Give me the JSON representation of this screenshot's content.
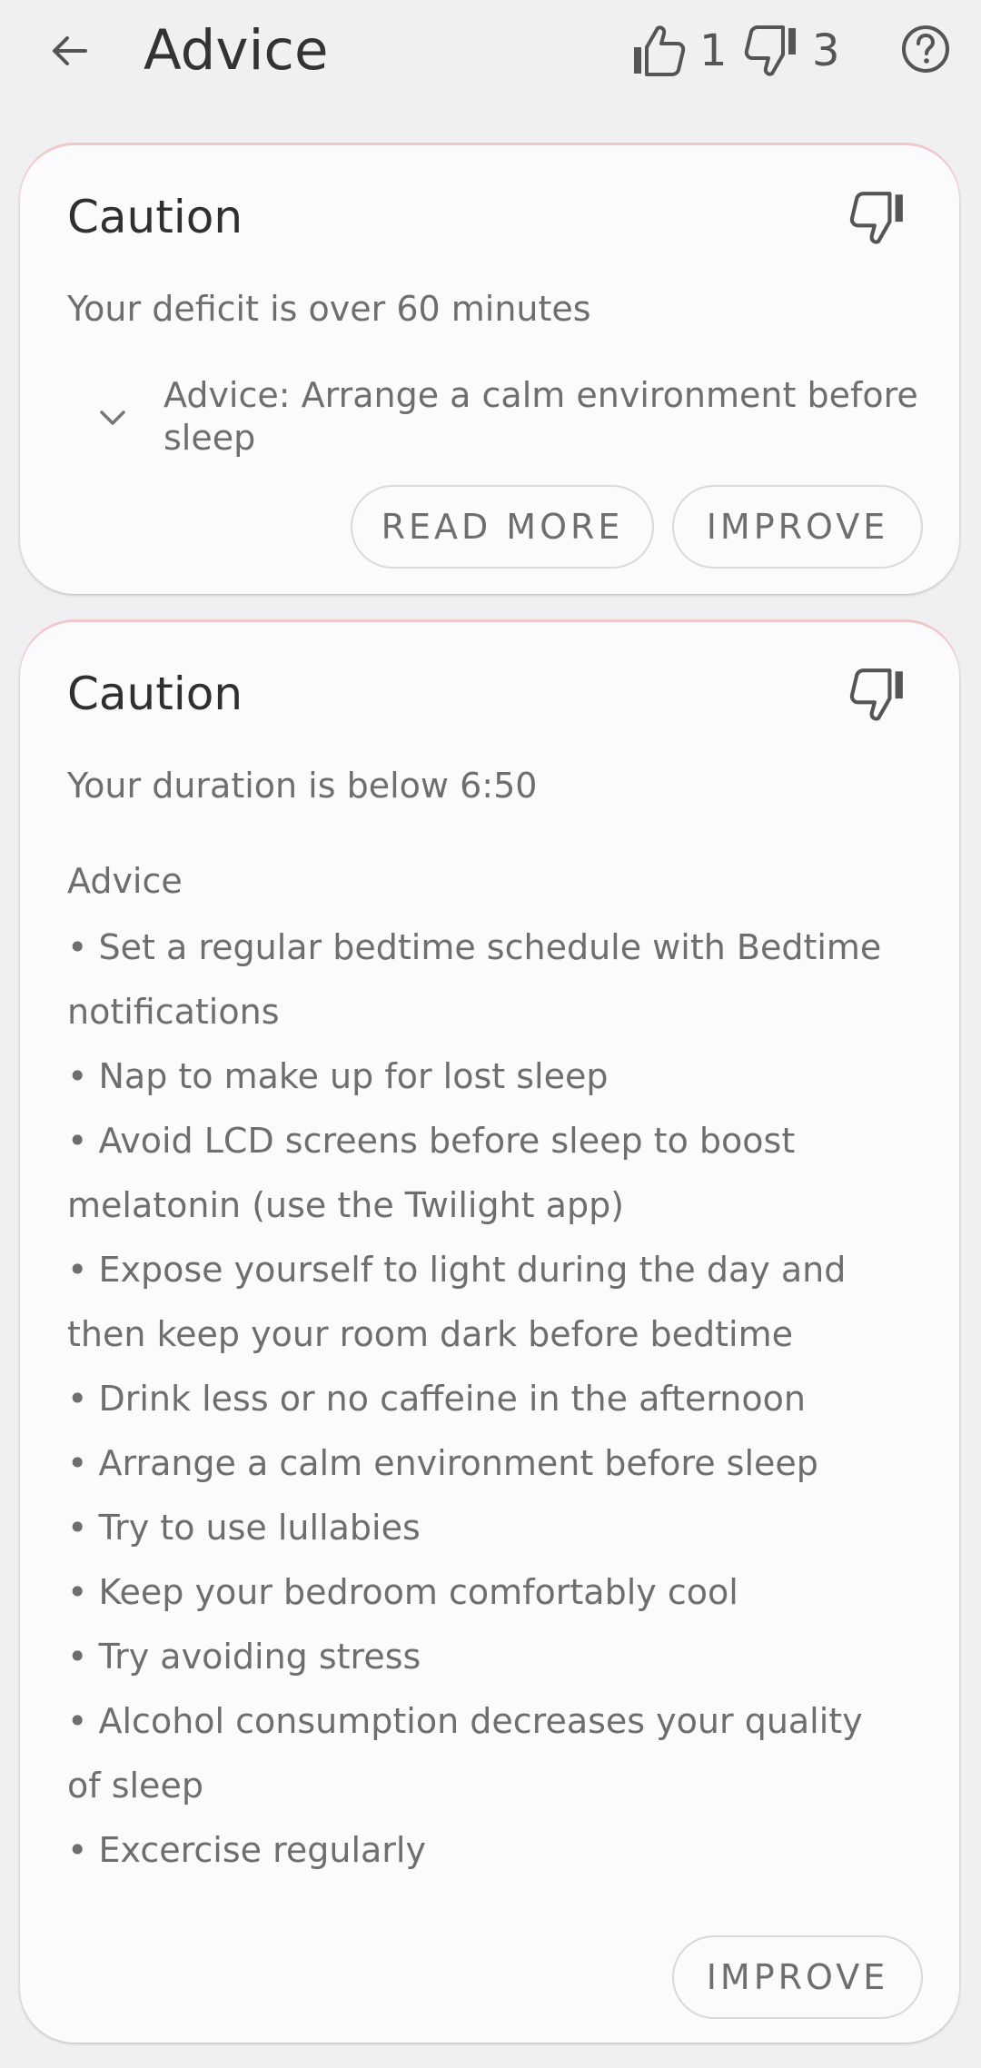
{
  "header": {
    "title": "Advice",
    "likes": "1",
    "dislikes": "3"
  },
  "cards": [
    {
      "title": "Caution",
      "description": "Your deficit is over 60 minutes",
      "advice": "Advice: Arrange a calm environment before sleep",
      "read_more_label": "READ MORE",
      "improve_label": "IMPROVE"
    },
    {
      "title": "Caution",
      "description": "Your duration is below 6:50",
      "advice_heading": "Advice",
      "advice_items": [
        "• Set a regular bedtime schedule with Bedtime notifications",
        "• Nap to make up for lost sleep",
        "• Avoid LCD screens before sleep to boost melatonin (use the Twilight app)",
        "• Expose yourself to light during the day and then keep your room dark before bedtime",
        "• Drink less or no caffeine in the afternoon",
        "• Arrange a calm environment before sleep",
        "• Try to use lullabies",
        "• Keep your bedroom comfortably cool",
        "• Try avoiding stress",
        "• Alcohol consumption decreases your quality of sleep",
        "• Excercise regularly"
      ],
      "improve_label": "IMPROVE"
    }
  ],
  "colors": {
    "background": "#f0f0f3",
    "card": "#fbfbfd",
    "text_primary": "#333333",
    "text_secondary": "#6e6e6e",
    "card_top_accent": "#f2c7c9"
  },
  "icons": [
    "back-arrow-icon",
    "thumbs-up-icon",
    "thumbs-down-icon",
    "help-icon",
    "chevron-down-icon"
  ]
}
